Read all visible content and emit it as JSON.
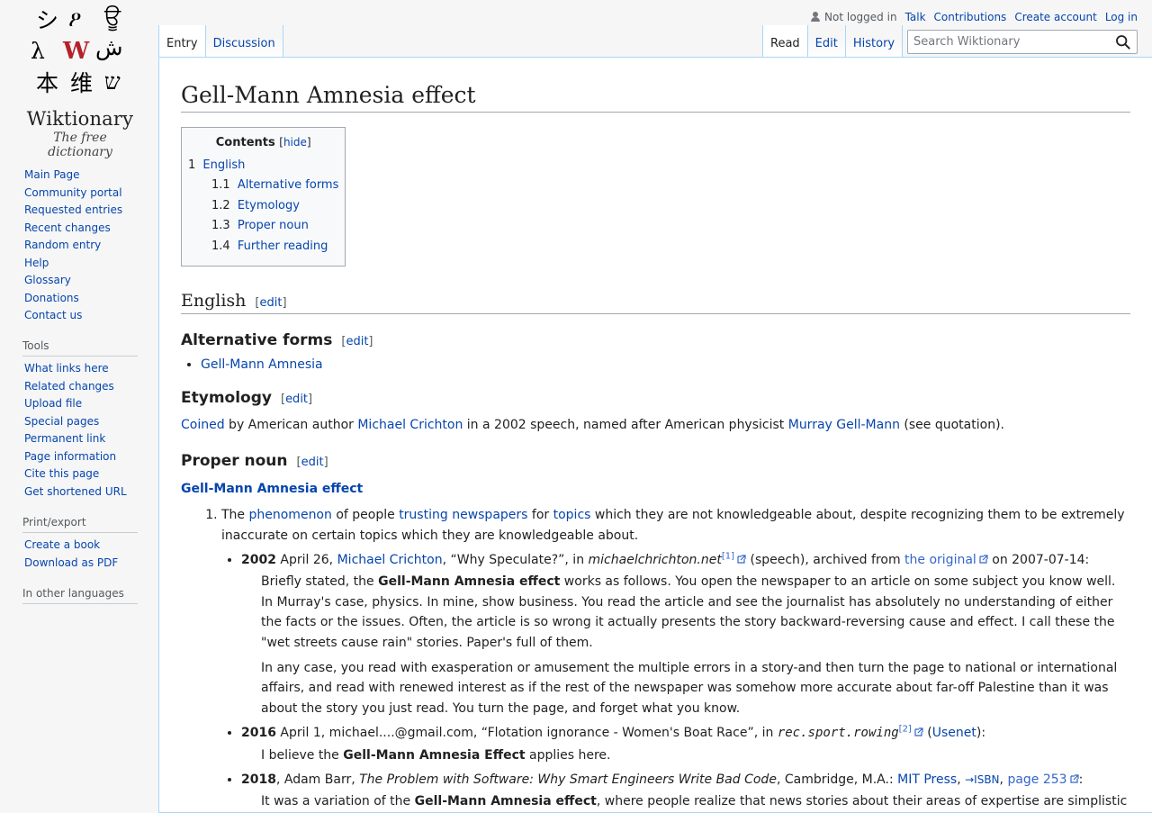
{
  "logo": {
    "glyphs": [
      "シ",
      "ዖ",
      "ਊ",
      "λ",
      "W",
      "ش",
      "本",
      "维",
      "ש"
    ],
    "wordmark": "Wiktionary",
    "tagline": "The free dictionary"
  },
  "sidebar": {
    "navigation": [
      "Main Page",
      "Community portal",
      "Requested entries",
      "Recent changes",
      "Random entry",
      "Help",
      "Glossary",
      "Donations",
      "Contact us"
    ],
    "tools_heading": "Tools",
    "tools": [
      "What links here",
      "Related changes",
      "Upload file",
      "Special pages",
      "Permanent link",
      "Page information",
      "Cite this page",
      "Get shortened URL"
    ],
    "print_heading": "Print/export",
    "print": [
      "Create a book",
      "Download as PDF"
    ],
    "languages_heading": "In other languages"
  },
  "personal": {
    "not_logged_in": "Not logged in",
    "talk": "Talk",
    "contributions": "Contributions",
    "create_account": "Create account",
    "log_in": "Log in"
  },
  "tabs": {
    "entry": "Entry",
    "discussion": "Discussion",
    "read": "Read",
    "edit": "Edit",
    "history": "History"
  },
  "search": {
    "placeholder": "Search Wiktionary"
  },
  "page": {
    "title": "Gell-Mann Amnesia effect",
    "toc": {
      "title": "Contents",
      "hide": "hide",
      "items": [
        {
          "num": "1",
          "label": "English"
        },
        {
          "num": "1.1",
          "label": "Alternative forms"
        },
        {
          "num": "1.2",
          "label": "Etymology"
        },
        {
          "num": "1.3",
          "label": "Proper noun"
        },
        {
          "num": "1.4",
          "label": "Further reading"
        }
      ]
    },
    "edit_label": "edit",
    "english_heading": "English",
    "alt_forms_heading": "Alternative forms",
    "alt_form": "Gell-Mann Amnesia",
    "etymology_heading": "Etymology",
    "etymology": {
      "coined": "Coined",
      "t1": " by American author ",
      "author": "Michael Crichton",
      "t2": " in a 2002 speech, named after American physicist ",
      "physicist": "Murray Gell-Mann",
      "t3": " (see quotation)."
    },
    "proper_noun_heading": "Proper noun",
    "headword": "Gell-Mann Amnesia effect",
    "definition": {
      "t1": "The ",
      "phenomenon": "phenomenon",
      "t2": " of people ",
      "trusting": "trusting",
      "newspapers": "newspapers",
      "t3": " for ",
      "topics": "topics",
      "t4": " which they are not knowledgeable about, despite recognizing them to be extremely inaccurate on certain topics which they are knowledgeable about."
    },
    "quotes": {
      "q1": {
        "year": "2002",
        "date": " April 26, ",
        "author": "Michael Crichton",
        "t1": ", “Why Speculate?”, in ",
        "source": "michaelchrichton.net",
        "ref": "[1]",
        "t2": " (speech), archived from ",
        "original": "the original",
        "t3": " on 2007-07-14:",
        "p1_a": "Briefly stated, the ",
        "p1_b": "Gell-Mann Amnesia effect",
        "p1_c": " works as follows. You open the newspaper to an article on some subject you know well. In Murray's case, physics. In mine, show business. You read the article and see the journalist has absolutely no understanding of either the facts or the issues. Often, the article is so wrong it actually presents the story backward-reversing cause and effect. I call these the \"wet streets cause rain\" stories. Paper's full of them.",
        "p2": "In any case, you read with exasperation or amusement the multiple errors in a story-and then turn the page to national or international affairs, and read with renewed interest as if the rest of the newspaper was somehow more accurate about far-off Palestine than it was about the story you just read. You turn the page, and forget what you know."
      },
      "q2": {
        "year": "2016",
        "t1": " April 1, michael....@gmail.com, “Flotation ignorance - Women's Boat Race”, in ",
        "newsgroup": "rec.sport.rowing",
        "ref": "[2]",
        "t2": " (",
        "usenet": "Usenet",
        "t3": "):",
        "p_a": "I believe the ",
        "p_b": "Gell-Mann Amnesia Effect",
        "p_c": " applies here."
      },
      "q3": {
        "year": "2018",
        "t1": ", Adam Barr, ",
        "book": "The Problem with Software: Why Smart Engineers Write Bad Code",
        "t2": ", Cambridge, M.A.: ",
        "publisher": "MIT Press",
        "t3": ", ",
        "isbn": "→ISBN",
        "t4": ", ",
        "page": "page 253",
        "t5": ":",
        "p_a": "It was a variation of the ",
        "p_b": "Gell-Mann Amnesia effect",
        "p_c": ", where people realize that news stories about their areas of expertise are simplistic"
      }
    }
  },
  "colors": {
    "link": "#0645ad",
    "external_link": "#3366cc",
    "tab_border": "#a7d7f9",
    "sidebar_bg": "#f6f6f6"
  }
}
